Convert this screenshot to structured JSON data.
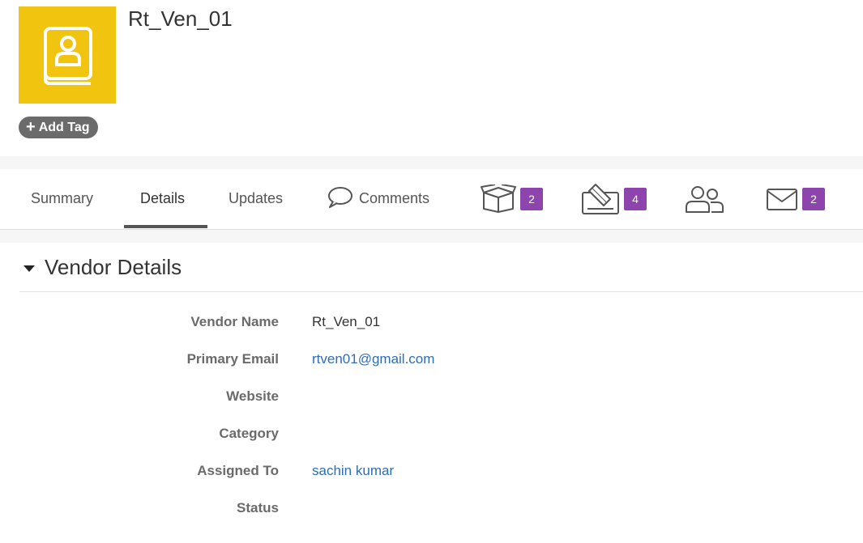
{
  "record": {
    "title": "Rt_Ven_01",
    "avatar_icon": "contact-book-icon",
    "avatar_color": "#f1c40f",
    "add_tag_label": "Add Tag"
  },
  "tabs": [
    {
      "label": "Summary"
    },
    {
      "label": "Details",
      "active": true
    },
    {
      "label": "Updates"
    },
    {
      "label": "Comments",
      "icon": "comment-bubble-icon"
    }
  ],
  "icon_tabs": [
    {
      "icon": "box-icon",
      "count": "2"
    },
    {
      "icon": "signature-icon",
      "count": "4"
    },
    {
      "icon": "users-icon"
    },
    {
      "icon": "envelope-icon",
      "count": "2"
    }
  ],
  "badge_color": "#8e44ad",
  "section": {
    "title": "Vendor Details",
    "fields": [
      {
        "label": "Vendor Name",
        "value": "Rt_Ven_01"
      },
      {
        "label": "Primary Email",
        "value": "rtven01@gmail.com"
      },
      {
        "label": "Website",
        "value": ""
      },
      {
        "label": "Category",
        "value": ""
      },
      {
        "label": "Assigned To",
        "value": "sachin kumar"
      },
      {
        "label": "Status",
        "value": ""
      }
    ]
  },
  "link_color": "#2e6db4"
}
